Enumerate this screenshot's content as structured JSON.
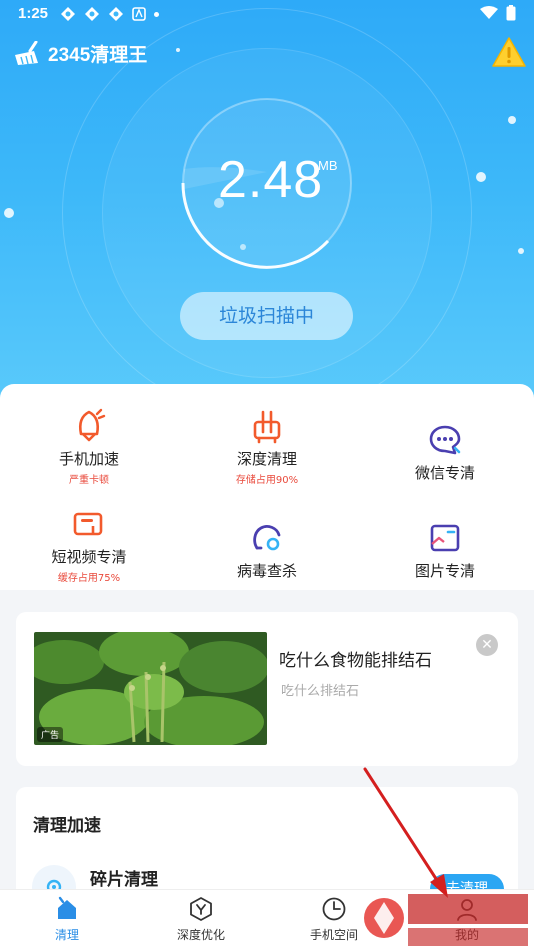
{
  "status_bar": {
    "time": "1:25"
  },
  "app": {
    "title": "2345清理王"
  },
  "scan": {
    "value": "2.48",
    "unit": "MB",
    "button_label": "垃圾扫描中"
  },
  "features": [
    {
      "label": "手机加速",
      "sub": "严重卡顿",
      "icon": "bell-rocket-icon"
    },
    {
      "label": "深度清理",
      "sub": "存储占用90%",
      "icon": "deep-clean-icon"
    },
    {
      "label": "微信专清",
      "sub": "",
      "icon": "wechat-icon"
    },
    {
      "label": "短视频专清",
      "sub": "缓存占用75%",
      "icon": "video-icon"
    },
    {
      "label": "病毒查杀",
      "sub": "",
      "icon": "virus-icon"
    },
    {
      "label": "图片专清",
      "sub": "",
      "icon": "image-icon"
    }
  ],
  "ad": {
    "title": "吃什么食物能排结石",
    "subtitle": "吃什么排结石",
    "badge": "广告"
  },
  "clean_section": {
    "title": "清理加速",
    "item_label": "碎片清理",
    "item_button": "去清理"
  },
  "bottom_nav": [
    {
      "label": "清理",
      "active": true
    },
    {
      "label": "深度优化",
      "active": false
    },
    {
      "label": "手机空间",
      "active": false
    },
    {
      "label": "我的",
      "active": false
    }
  ],
  "colors": {
    "hero_top": "#2eaaf8",
    "accent": "#2a8ee6",
    "warning": "#e94a3c"
  }
}
